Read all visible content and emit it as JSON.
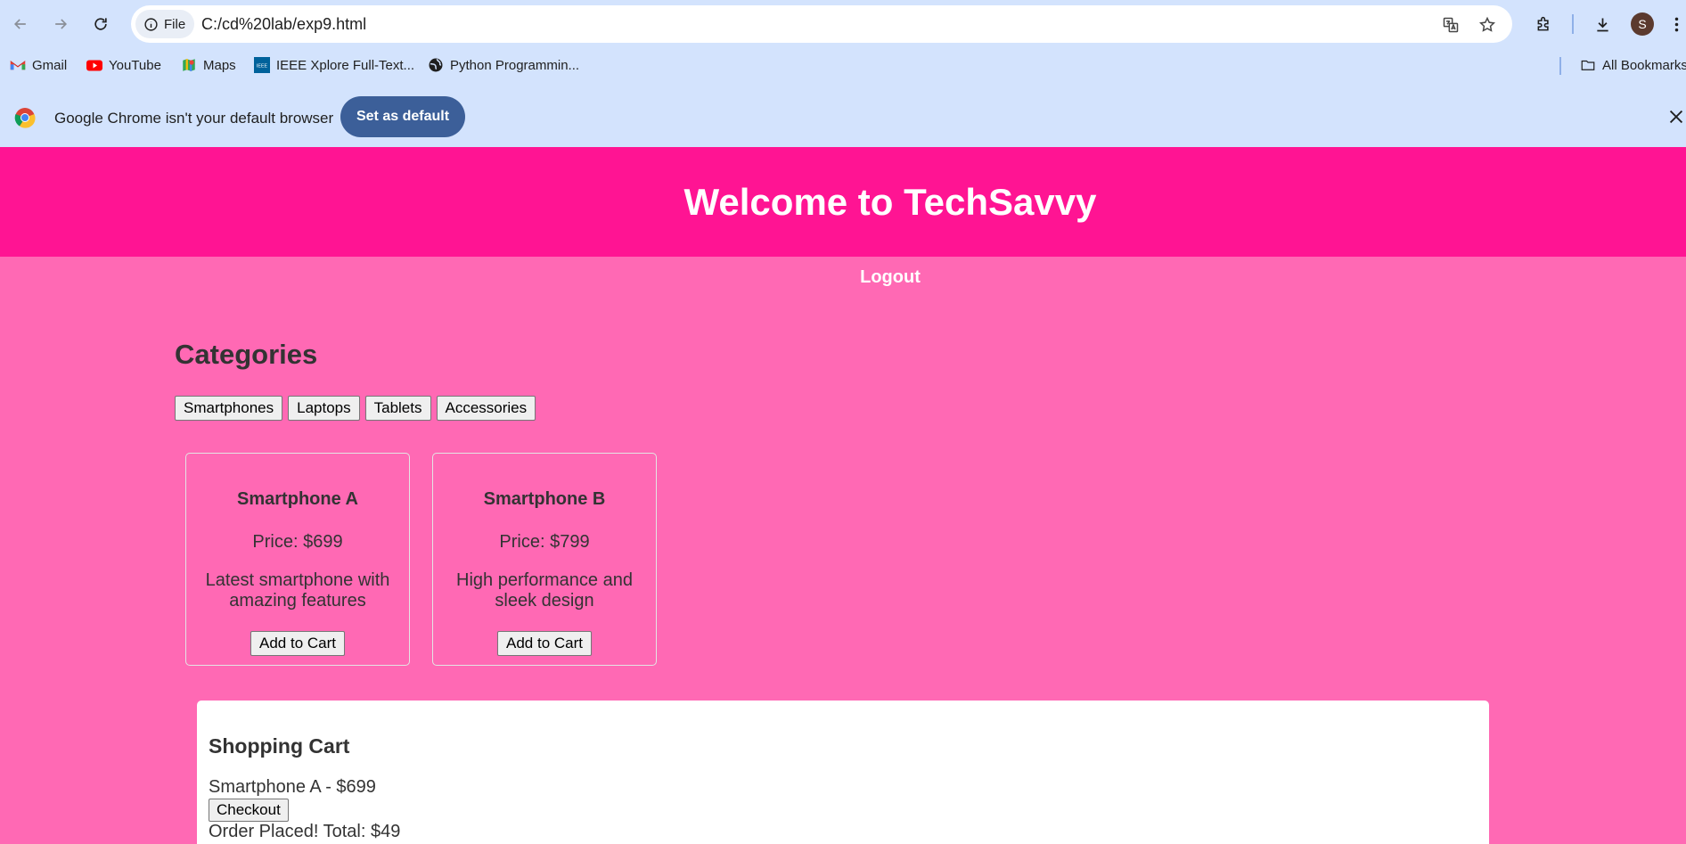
{
  "browser": {
    "url": "C:/cd%20lab/exp9.html",
    "site_chip_label": "File",
    "avatar_letter": "S",
    "bookmarks": [
      {
        "label": "Gmail",
        "icon": "gmail-icon"
      },
      {
        "label": "YouTube",
        "icon": "youtube-icon"
      },
      {
        "label": "Maps",
        "icon": "maps-icon"
      },
      {
        "label": "IEEE Xplore Full-Text...",
        "icon": "ieee-icon"
      },
      {
        "label": "Python Programmin...",
        "icon": "globe-icon"
      }
    ],
    "all_bookmarks_label": "All Bookmarks",
    "infobar": {
      "message": "Google Chrome isn't your default browser",
      "button_label": "Set as default"
    }
  },
  "page": {
    "header_title": "Welcome to TechSavvy",
    "nav_logout": "Logout",
    "categories_title": "Categories",
    "categories": [
      "Smartphones",
      "Laptops",
      "Tablets",
      "Accessories"
    ],
    "products": [
      {
        "name": "Smartphone A",
        "price": "Price: $699",
        "description": "Latest smartphone with amazing features",
        "button": "Add to Cart"
      },
      {
        "name": "Smartphone B",
        "price": "Price: $799",
        "description": "High performance and sleek design",
        "button": "Add to Cart"
      }
    ],
    "cart": {
      "title": "Shopping Cart",
      "items": [
        "Smartphone A - $699"
      ],
      "checkout_label": "Checkout",
      "order_message": "Order Placed! Total: $49"
    }
  },
  "colors": {
    "header_bg": "#ff1493",
    "page_bg": "#ff69b4",
    "chrome_bg": "#d3e3fd",
    "default_button_bg": "#3c5f99"
  }
}
